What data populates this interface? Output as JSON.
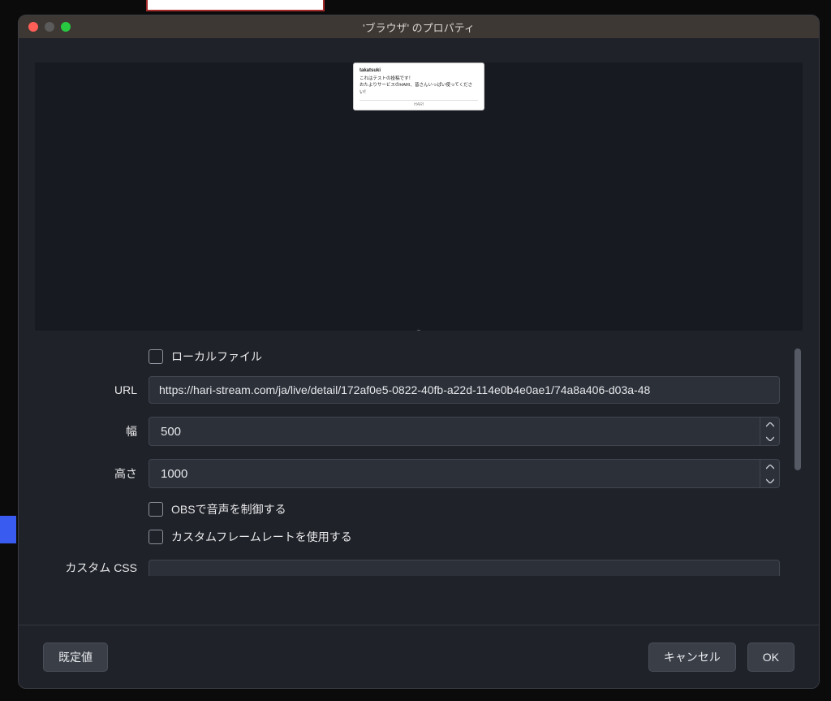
{
  "window": {
    "title": "'ブラウザ' のプロパティ"
  },
  "preview": {
    "username": "takatsuki",
    "line1": "これはテストの投稿です！",
    "line2": "おたよりサービスのHARI、皆さんいっぱい使ってください！",
    "footer": "HARI"
  },
  "form": {
    "local_file_label": "ローカルファイル",
    "url_label": "URL",
    "url_value": "https://hari-stream.com/ja/live/detail/172af0e5-0822-40fb-a22d-114e0b4e0ae1/74a8a406-d03a-48",
    "width_label": "幅",
    "width_value": "500",
    "height_label": "高さ",
    "height_value": "1000",
    "obs_audio_label": "OBSで音声を制御する",
    "custom_fps_label": "カスタムフレームレートを使用する",
    "custom_css_label": "カスタム CSS"
  },
  "buttons": {
    "defaults": "既定値",
    "cancel": "キャンセル",
    "ok": "OK"
  }
}
